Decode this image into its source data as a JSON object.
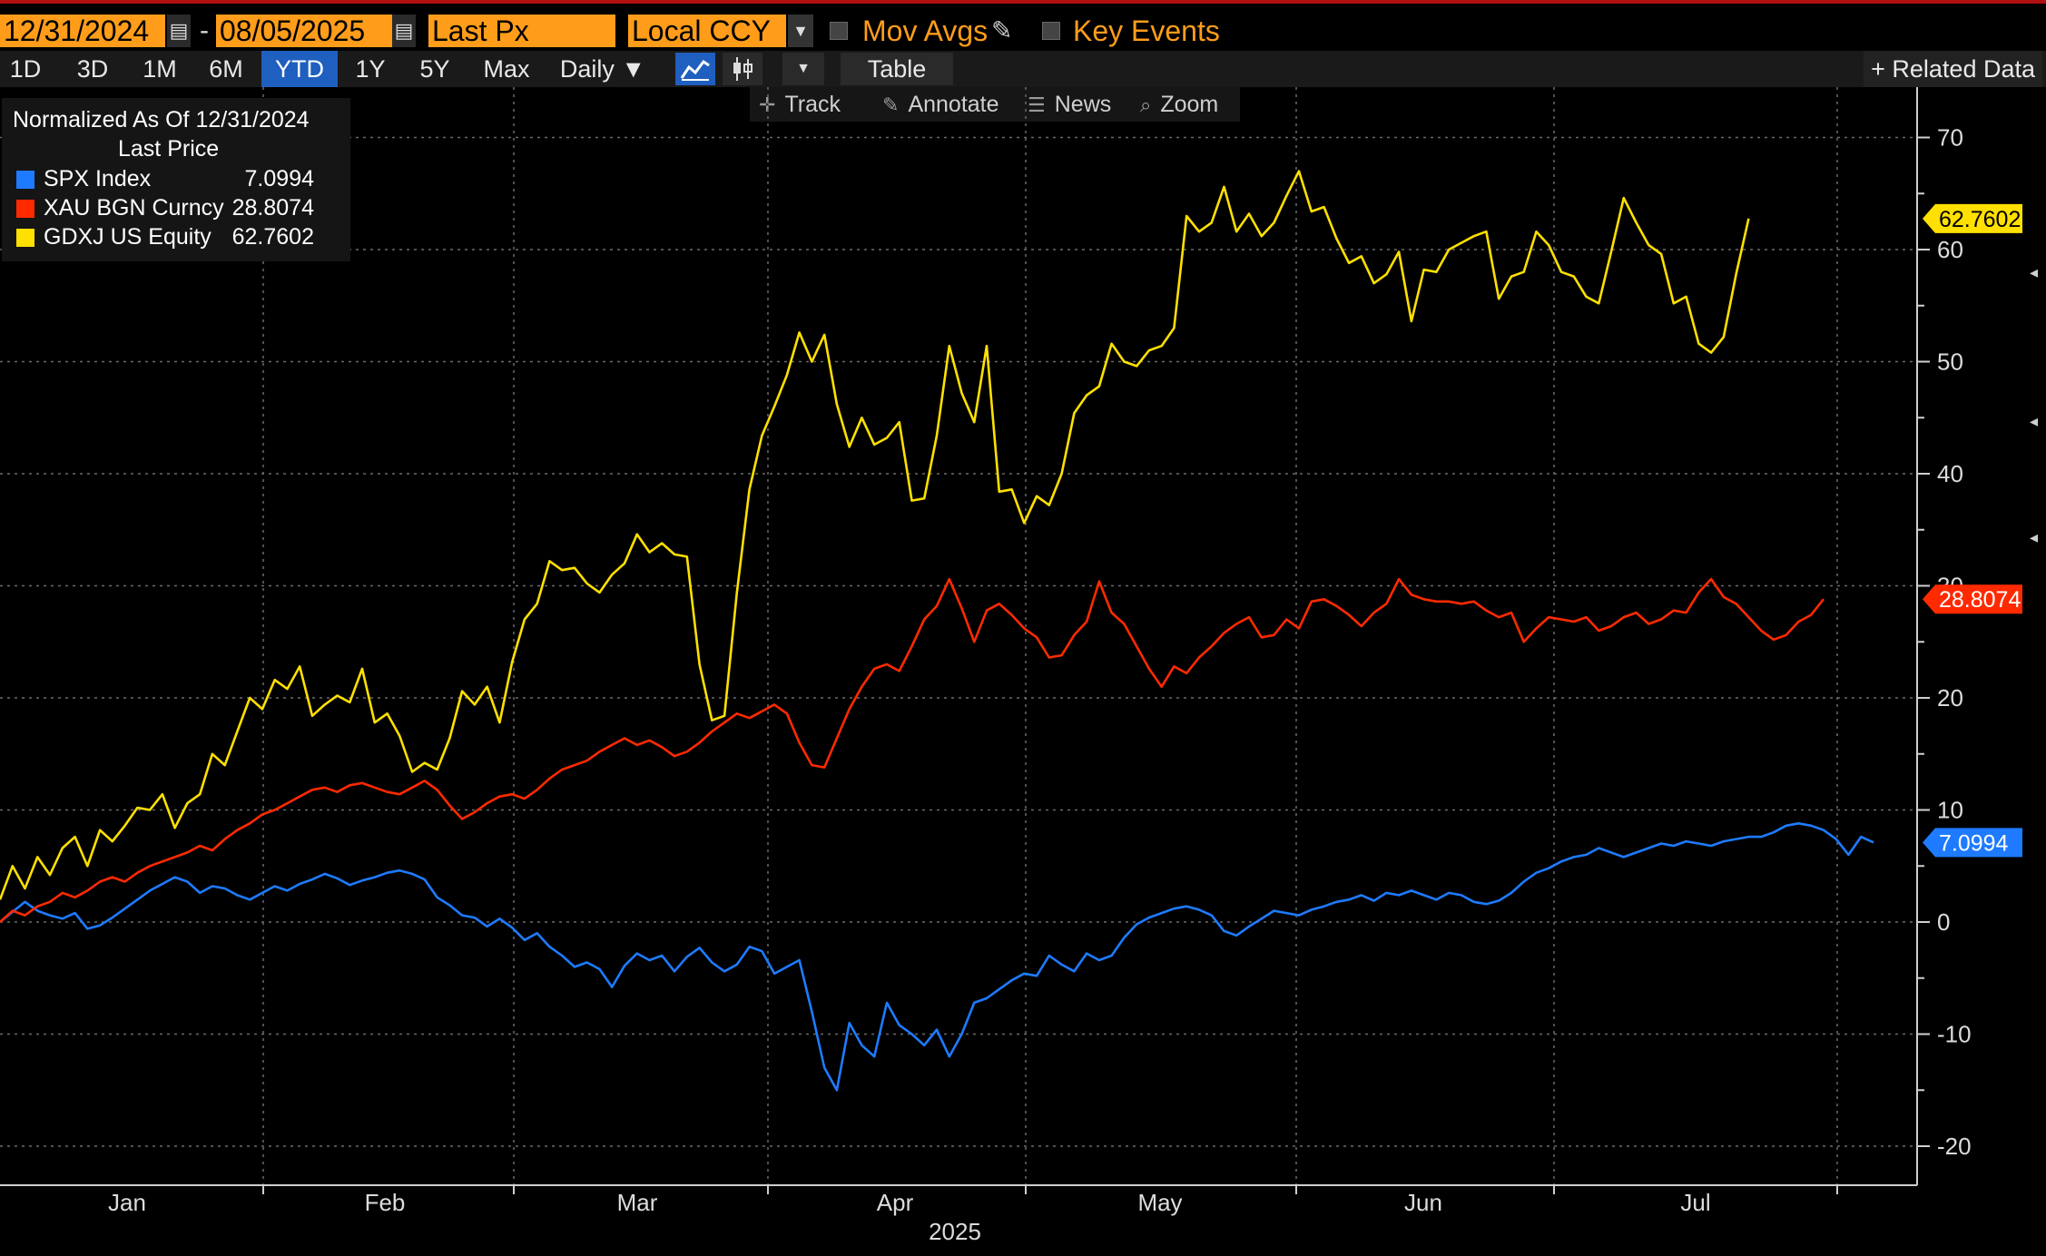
{
  "range": {
    "start_date": "12/31/2024",
    "separator": "-",
    "end_date": "08/05/2025",
    "field": "Last Px",
    "currency": "Local CCY",
    "mov_avgs_label": "Mov Avgs",
    "key_events_label": "Key Events"
  },
  "periods": [
    "1D",
    "3D",
    "1M",
    "6M",
    "YTD",
    "1Y",
    "5Y",
    "Max"
  ],
  "active_period": "YTD",
  "frequency_label": "Daily ▼",
  "table_label": "Table",
  "related_label": "+ Related Data",
  "tools": {
    "track": "Track",
    "annotate": "Annotate",
    "news": "News",
    "zoom": "Zoom"
  },
  "legend": {
    "title": "Normalized As Of 12/31/2024",
    "subtitle": "Last Price",
    "rows": [
      {
        "name": "SPX Index",
        "value": "7.0994",
        "color": "#1e7bff"
      },
      {
        "name": "XAU BGN Curncy",
        "value": "28.8074",
        "color": "#ff2a00"
      },
      {
        "name": "GDXJ US Equity",
        "value": "62.7602",
        "color": "#ffe000"
      }
    ]
  },
  "chart_data": {
    "type": "line",
    "x_label_months": [
      "Jan",
      "Feb",
      "Mar",
      "Apr",
      "May",
      "Jun",
      "Jul"
    ],
    "year_label": "2025",
    "y_ticks": [
      70,
      60,
      50,
      40,
      30,
      20,
      10,
      0,
      -10,
      -20
    ],
    "ylim": [
      -23,
      72
    ],
    "grid": true,
    "series": [
      {
        "name": "SPX Index",
        "color": "#1e7bff",
        "last_value": "7.0994",
        "values": [
          0,
          0.9,
          1.8,
          1.0,
          0.6,
          0.3,
          0.8,
          -0.6,
          -0.3,
          0.4,
          1.2,
          2.0,
          2.8,
          3.4,
          4.0,
          3.6,
          2.6,
          3.2,
          3.0,
          2.4,
          2.0,
          2.6,
          3.2,
          2.8,
          3.4,
          3.8,
          4.3,
          3.9,
          3.3,
          3.7,
          4.0,
          4.4,
          4.6,
          4.3,
          3.8,
          2.2,
          1.5,
          0.6,
          0.4,
          -0.4,
          0.3,
          -0.5,
          -1.6,
          -1.0,
          -2.2,
          -3.0,
          -4.0,
          -3.6,
          -4.2,
          -5.8,
          -3.9,
          -2.8,
          -3.4,
          -3.0,
          -4.4,
          -3.1,
          -2.3,
          -3.6,
          -4.4,
          -3.8,
          -2.2,
          -2.6,
          -4.6,
          -4.0,
          -3.4,
          -8.0,
          -13.0,
          -15.0,
          -9.0,
          -11.0,
          -12.0,
          -7.2,
          -9.2,
          -10.0,
          -11.0,
          -9.6,
          -12.0,
          -10.0,
          -7.2,
          -6.8,
          -6.0,
          -5.2,
          -4.6,
          -4.8,
          -3.0,
          -3.8,
          -4.4,
          -2.8,
          -3.4,
          -3.0,
          -1.4,
          -0.2,
          0.4,
          0.8,
          1.2,
          1.4,
          1.1,
          0.6,
          -0.8,
          -1.2,
          -0.4,
          0.3,
          1.0,
          0.8,
          0.6,
          1.1,
          1.4,
          1.8,
          2.0,
          2.4,
          1.9,
          2.6,
          2.4,
          2.8,
          2.4,
          2.0,
          2.6,
          2.4,
          1.8,
          1.6,
          1.9,
          2.6,
          3.6,
          4.4,
          4.8,
          5.4,
          5.8,
          6.0,
          6.6,
          6.2,
          5.8,
          6.2,
          6.6,
          7.0,
          6.8,
          7.2,
          7.0,
          6.8,
          7.2,
          7.4,
          7.6,
          7.6,
          8.0,
          8.6,
          8.8,
          8.6,
          8.2,
          7.4,
          6.0,
          7.6,
          7.0994
        ]
      },
      {
        "name": "XAU BGN Curncy",
        "color": "#ff2a00",
        "last_value": "28.8074",
        "values": [
          0,
          1.0,
          0.6,
          1.4,
          1.8,
          2.6,
          2.2,
          2.8,
          3.6,
          4.0,
          3.6,
          4.4,
          5.0,
          5.4,
          5.8,
          6.2,
          6.8,
          6.4,
          7.4,
          8.2,
          8.8,
          9.6,
          10.0,
          10.6,
          11.2,
          11.8,
          12.0,
          11.6,
          12.2,
          12.4,
          12.0,
          11.6,
          11.4,
          12.0,
          12.6,
          11.8,
          10.4,
          9.2,
          9.8,
          10.6,
          11.2,
          11.4,
          11.0,
          11.8,
          12.8,
          13.6,
          14.0,
          14.4,
          15.2,
          15.8,
          16.4,
          15.8,
          16.2,
          15.6,
          14.8,
          15.2,
          16.0,
          17.0,
          17.8,
          18.6,
          18.2,
          18.8,
          19.4,
          18.6,
          16.0,
          14.0,
          13.8,
          16.4,
          19.0,
          21.0,
          22.6,
          23.0,
          22.4,
          24.6,
          27.0,
          28.2,
          30.6,
          28.0,
          25.0,
          27.8,
          28.4,
          27.4,
          26.2,
          25.4,
          23.6,
          23.8,
          25.6,
          26.8,
          30.4,
          27.6,
          26.6,
          24.6,
          22.6,
          21.0,
          22.8,
          22.2,
          23.6,
          24.6,
          25.8,
          26.6,
          27.2,
          25.4,
          25.6,
          27.0,
          26.2,
          28.6,
          28.8,
          28.2,
          27.4,
          26.4,
          27.6,
          28.4,
          30.6,
          29.2,
          28.8,
          28.6,
          28.6,
          28.4,
          28.6,
          27.8,
          27.2,
          27.6,
          25.0,
          26.2,
          27.2,
          27.0,
          26.8,
          27.2,
          26.0,
          26.4,
          27.2,
          27.6,
          26.6,
          27.0,
          27.8,
          27.6,
          29.4,
          30.6,
          29.0,
          28.4,
          27.2,
          26.0,
          25.2,
          25.6,
          26.8,
          27.4,
          28.8074
        ]
      },
      {
        "name": "GDXJ US Equity",
        "color": "#ffe000",
        "last_value": "62.7602",
        "values": [
          2.0,
          5.0,
          3.0,
          5.8,
          4.2,
          6.6,
          7.6,
          5.0,
          8.2,
          7.2,
          8.6,
          10.2,
          10.0,
          11.4,
          8.4,
          10.6,
          11.4,
          15.0,
          14.0,
          17.0,
          20.0,
          19.0,
          21.6,
          20.8,
          22.8,
          18.4,
          19.4,
          20.2,
          19.6,
          22.6,
          17.8,
          18.6,
          16.6,
          13.4,
          14.2,
          13.6,
          16.4,
          20.6,
          19.4,
          21.0,
          17.8,
          23.2,
          27.0,
          28.4,
          32.2,
          31.4,
          31.6,
          30.2,
          29.4,
          31.0,
          32.0,
          34.6,
          33.0,
          33.8,
          32.8,
          32.6,
          23.0,
          18.0,
          18.4,
          29.4,
          38.6,
          43.4,
          46.0,
          48.8,
          52.6,
          50.0,
          52.4,
          46.2,
          42.4,
          45.0,
          42.6,
          43.2,
          44.6,
          37.6,
          37.8,
          43.4,
          51.4,
          47.2,
          44.6,
          51.4,
          38.4,
          38.6,
          35.6,
          38.0,
          37.2,
          40.0,
          45.4,
          47.0,
          47.8,
          51.6,
          50.0,
          49.6,
          51.0,
          51.4,
          53.0,
          63.0,
          61.6,
          62.4,
          65.6,
          61.6,
          63.2,
          61.2,
          62.4,
          64.8,
          67.0,
          63.4,
          63.8,
          61.0,
          58.8,
          59.4,
          57.0,
          57.8,
          59.8,
          53.6,
          58.2,
          58.0,
          60.0,
          60.6,
          61.2,
          61.6,
          55.6,
          57.6,
          58.0,
          61.6,
          60.4,
          58.0,
          57.6,
          55.8,
          55.2,
          59.8,
          64.6,
          62.4,
          60.4,
          59.6,
          55.2,
          55.8,
          51.6,
          50.8,
          52.2,
          57.8,
          62.7602
        ]
      }
    ]
  }
}
